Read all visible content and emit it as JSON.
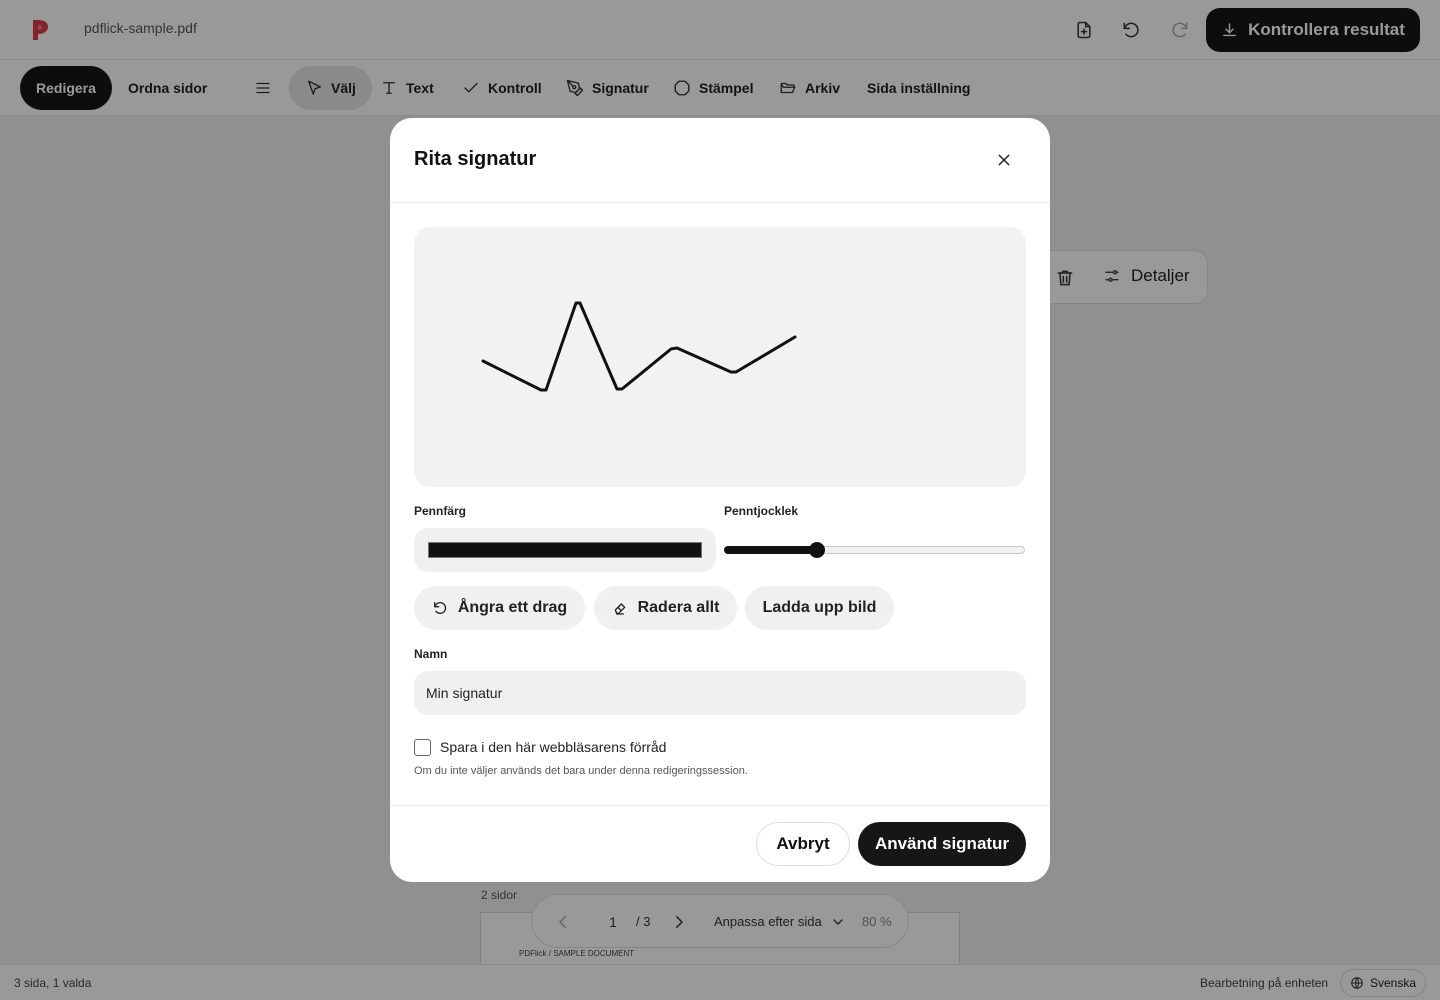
{
  "app": {
    "filename": "pdflick-sample.pdf",
    "brand_color": "#e03a4e"
  },
  "topbar": {
    "icons": [
      "file-plus-icon",
      "undo-icon",
      "redo-icon"
    ],
    "primary_label": "Kontrollera resultat"
  },
  "toolbar": {
    "mode_edit": "Redigera",
    "mode_arrange": "Ordna sidor",
    "tools": {
      "select": "Välj",
      "text": "Text",
      "check": "Kontroll",
      "signature": "Signatur",
      "stamp": "Stämpel",
      "archive": "Arkiv",
      "page_settings": "Sida inställning"
    }
  },
  "selection_toolbar": {
    "details_label": "Detaljer"
  },
  "document": {
    "pages_label": "2 sidor",
    "thumb_text": "PDFlick / SAMPLE DOCUMENT"
  },
  "pager": {
    "current_page": "1",
    "total": "/ 3",
    "zoom_mode": "Anpassa efter sida",
    "zoom": "80 %"
  },
  "status": {
    "left": "3 sida, 1 valda",
    "right": "Bearbetning på enheten",
    "language": "Svenska"
  },
  "modal": {
    "title": "Rita signatur",
    "pen_color_label": "Pennfärg",
    "pen_color": "#111111",
    "pen_width_label": "Penntjocklek",
    "pen_width_fraction": 0.31,
    "undo_label": "Ångra ett drag",
    "clear_label": "Radera allt",
    "upload_label": "Ladda upp bild",
    "name_label": "Namn",
    "name_value": "Min signatur",
    "save_label": "Spara i den här webbläsarens förråd",
    "save_checked": false,
    "hint": "Om du inte väljer används det bara under denna redigeringssession.",
    "cancel_label": "Avbryt",
    "apply_label": "Använd signatur"
  }
}
